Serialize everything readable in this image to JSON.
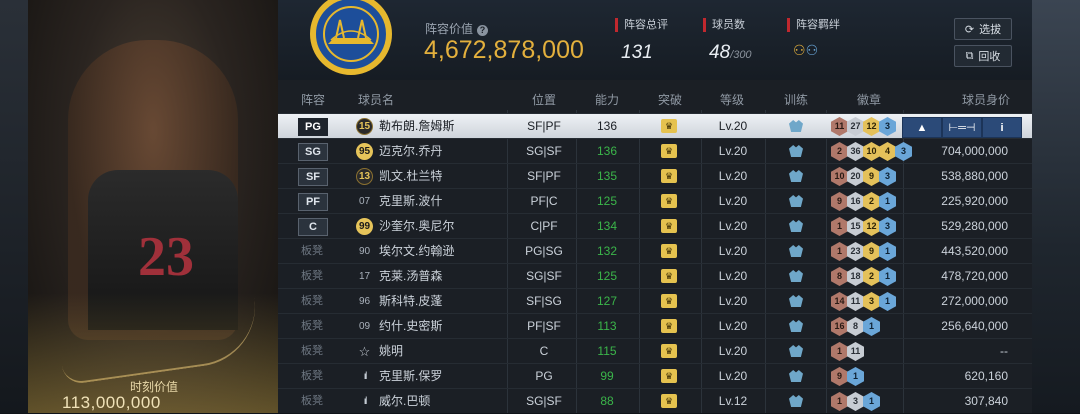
{
  "card": {
    "moment_label": "时刻价值",
    "moment_value": "113,000,000",
    "jersey_number": "23"
  },
  "header": {
    "lineup_value_label": "阵容价值",
    "help_icon": "?",
    "lineup_value": "4,672,878,000",
    "rating_label": "阵容总评",
    "rating_value": "131",
    "players_label": "球员数",
    "players_value": "48",
    "players_max": "/300",
    "bond_label": "阵容羁绊",
    "filter_button": "选拔",
    "recycle_button": "回收"
  },
  "columns": [
    "阵容",
    "球员名",
    "位置",
    "能力",
    "突破",
    "等级",
    "训练",
    "徽章",
    "球员身价"
  ],
  "colors": {
    "accent_gold": "#e3b03d",
    "highlight_green": "#3bb54a",
    "panel": "#1b1f25"
  },
  "rows": [
    {
      "slot": "PG",
      "tag": "15",
      "tagstyle": "dark",
      "name": "勒布朗.詹姆斯",
      "pos": "SF|PF",
      "ability": "136",
      "level": "Lv.20",
      "badges": [
        [
          "h-br",
          "11"
        ],
        [
          "h-sv",
          "27"
        ],
        [
          "h-gd",
          "12"
        ],
        [
          "h-bl",
          "3"
        ]
      ],
      "value": "",
      "selected": true
    },
    {
      "slot": "SG",
      "tag": "95",
      "tagstyle": "gold",
      "name": "迈克尔.乔丹",
      "pos": "SG|SF",
      "ability": "136",
      "level": "Lv.20",
      "badges": [
        [
          "h-br",
          "2"
        ],
        [
          "h-sv",
          "36"
        ],
        [
          "h-gd",
          "10"
        ],
        [
          "h-gd",
          "4"
        ],
        [
          "h-bl",
          "3"
        ]
      ],
      "value": "704,000,000"
    },
    {
      "slot": "SF",
      "tag": "13",
      "tagstyle": "dark",
      "name": "凯文.杜兰特",
      "pos": "SF|PF",
      "ability": "135",
      "level": "Lv.20",
      "badges": [
        [
          "h-br",
          "10"
        ],
        [
          "h-sv",
          "20"
        ],
        [
          "h-gd",
          "9"
        ],
        [
          "h-bl",
          "3"
        ]
      ],
      "value": "538,880,000"
    },
    {
      "slot": "PF",
      "tag": "07",
      "tagstyle": "plain",
      "name": "克里斯.波什",
      "pos": "PF|C",
      "ability": "125",
      "level": "Lv.20",
      "badges": [
        [
          "h-br",
          "9"
        ],
        [
          "h-sv",
          "16"
        ],
        [
          "h-gd",
          "2"
        ],
        [
          "h-bl",
          "1"
        ]
      ],
      "value": "225,920,000"
    },
    {
      "slot": "C",
      "tag": "99",
      "tagstyle": "gold",
      "name": "沙奎尔.奥尼尔",
      "pos": "C|PF",
      "ability": "134",
      "level": "Lv.20",
      "badges": [
        [
          "h-br",
          "1"
        ],
        [
          "h-sv",
          "15"
        ],
        [
          "h-gd",
          "12"
        ],
        [
          "h-bl",
          "3"
        ]
      ],
      "value": "529,280,000"
    },
    {
      "slot": "板凳",
      "tag": "90",
      "tagstyle": "plain",
      "name": "埃尔文.约翰逊",
      "pos": "PG|SG",
      "ability": "132",
      "level": "Lv.20",
      "badges": [
        [
          "h-br",
          "1"
        ],
        [
          "h-sv",
          "23"
        ],
        [
          "h-gd",
          "9"
        ],
        [
          "h-bl",
          "1"
        ]
      ],
      "value": "443,520,000"
    },
    {
      "slot": "板凳",
      "tag": "17",
      "tagstyle": "plain",
      "name": "克莱.汤普森",
      "pos": "SG|SF",
      "ability": "125",
      "level": "Lv.20",
      "badges": [
        [
          "h-br",
          "8"
        ],
        [
          "h-sv",
          "18"
        ],
        [
          "h-gd",
          "2"
        ],
        [
          "h-bl",
          "1"
        ]
      ],
      "value": "478,720,000"
    },
    {
      "slot": "板凳",
      "tag": "96",
      "tagstyle": "plain",
      "name": "斯科特.皮蓬",
      "pos": "SF|SG",
      "ability": "127",
      "level": "Lv.20",
      "badges": [
        [
          "h-br",
          "14"
        ],
        [
          "h-sv",
          "11"
        ],
        [
          "h-gd",
          "3"
        ],
        [
          "h-bl",
          "1"
        ]
      ],
      "value": "272,000,000"
    },
    {
      "slot": "板凳",
      "tag": "09",
      "tagstyle": "plain",
      "name": "约什.史密斯",
      "pos": "PF|SF",
      "ability": "113",
      "level": "Lv.20",
      "badges": [
        [
          "h-br",
          "16"
        ],
        [
          "h-sv",
          "8"
        ],
        [
          "h-bl",
          "1"
        ]
      ],
      "value": "256,640,000"
    },
    {
      "slot": "板凳",
      "tag": "☆",
      "tagstyle": "star",
      "name": "姚明",
      "pos": "C",
      "ability": "115",
      "level": "Lv.20",
      "badges": [
        [
          "h-br",
          "1"
        ],
        [
          "h-sv",
          "11"
        ]
      ],
      "value": "--"
    },
    {
      "slot": "板凳",
      "tag": "ııl",
      "tagstyle": "bars",
      "name": "克里斯.保罗",
      "pos": "PG",
      "ability": "99",
      "level": "Lv.20",
      "badges": [
        [
          "h-br",
          "9"
        ],
        [
          "h-bl",
          "1"
        ]
      ],
      "value": "620,160"
    },
    {
      "slot": "板凳",
      "tag": "ııl",
      "tagstyle": "bars",
      "name": "威尔.巴顿",
      "pos": "SG|SF",
      "ability": "88",
      "level": "Lv.12",
      "badges": [
        [
          "h-br",
          "1"
        ],
        [
          "h-sv",
          "3"
        ],
        [
          "h-bl",
          "1"
        ]
      ],
      "value": "307,840"
    }
  ]
}
